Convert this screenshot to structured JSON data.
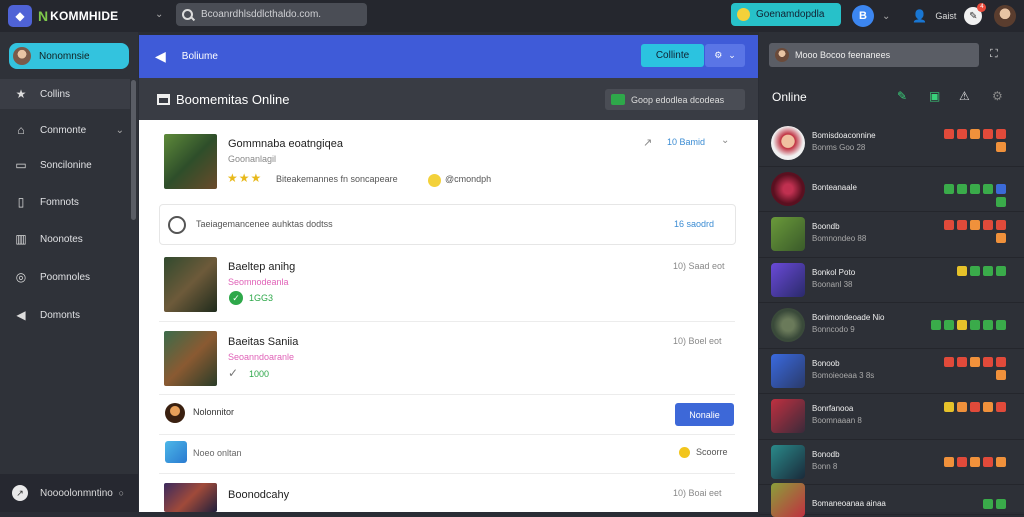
{
  "topbar": {
    "logo_text": "KOMMHIDE",
    "search_placeholder": "Bcoanrdhlsddlcthaldo.com.",
    "promo_label": "Goenamdopdla",
    "blue_badge_letter": "B",
    "user_label": "Gaist",
    "notif_count": "4"
  },
  "sidebar": {
    "active_label": "Nonomnsie",
    "items": [
      {
        "label": "Collins",
        "icon": "star-icon"
      },
      {
        "label": "Conmonte",
        "icon": "home-icon"
      },
      {
        "label": "Soncilonine",
        "icon": "inbox-icon"
      },
      {
        "label": "Fomnots",
        "icon": "document-icon"
      },
      {
        "label": "Noonotes",
        "icon": "book-icon"
      },
      {
        "label": "Poomnoles",
        "icon": "globe-icon"
      },
      {
        "label": "Domonts",
        "icon": "megaphone-icon"
      }
    ],
    "bottom_label": "Noooolonmntino"
  },
  "main": {
    "header_title": "Boliume",
    "header_button": "Collinte",
    "sub_title": "Boomemitas Online",
    "sub_button": "Goop edodlea dcodeas",
    "feed": [
      {
        "title": "Gommnaba eoatngiqea",
        "subtitle": "Goonanlagil",
        "meta": "Biteakemannes fn soncapeare",
        "extra": "@cmondph",
        "right": "10 Bamid"
      },
      {
        "title": "Baeltep anihg",
        "subtitle": "Seomnodeanla",
        "badge": "1GG3",
        "right": "10) Saad  eot"
      },
      {
        "title": "Baeitas Saniia",
        "subtitle": "Seoanndoaranle",
        "badge": "1000",
        "right": "10) Boel  eot"
      },
      {
        "title": "Boonodcahy",
        "right": "10) Boai  eet"
      }
    ],
    "info_box_text": "Taeiagemancenee auhktas dodtss",
    "info_box_link": "16 saodrd",
    "person_row_name": "Nolonnitor",
    "person_row_button": "Nonalie",
    "note_row_text": "Noeo onltan",
    "note_row_right": "Scoorre"
  },
  "right_panel": {
    "search_text": "Mooo Bocoo feenanees",
    "title": "Online",
    "contacts": [
      {
        "name": "Bomisdoaconnine",
        "sub": "Bonms Goo 28"
      },
      {
        "name": "Bonteanaale",
        "sub": ""
      },
      {
        "name": "Boondb",
        "sub": "Bomnondeo 88"
      },
      {
        "name": "Bonkol      Poto",
        "sub": "Boonanl 38"
      },
      {
        "name": "Bonimondeoade Nio",
        "sub": "Bonncodo 9"
      },
      {
        "name": "Bonoob",
        "sub": "Bomoieoeaa 3 8s"
      },
      {
        "name": "Bonrfanooa",
        "sub": "Boomnaaan 8"
      },
      {
        "name": "Bonodb",
        "sub": "Bonn 8"
      },
      {
        "name": "Bomaneoanaa ainaa",
        "sub": ""
      }
    ]
  }
}
